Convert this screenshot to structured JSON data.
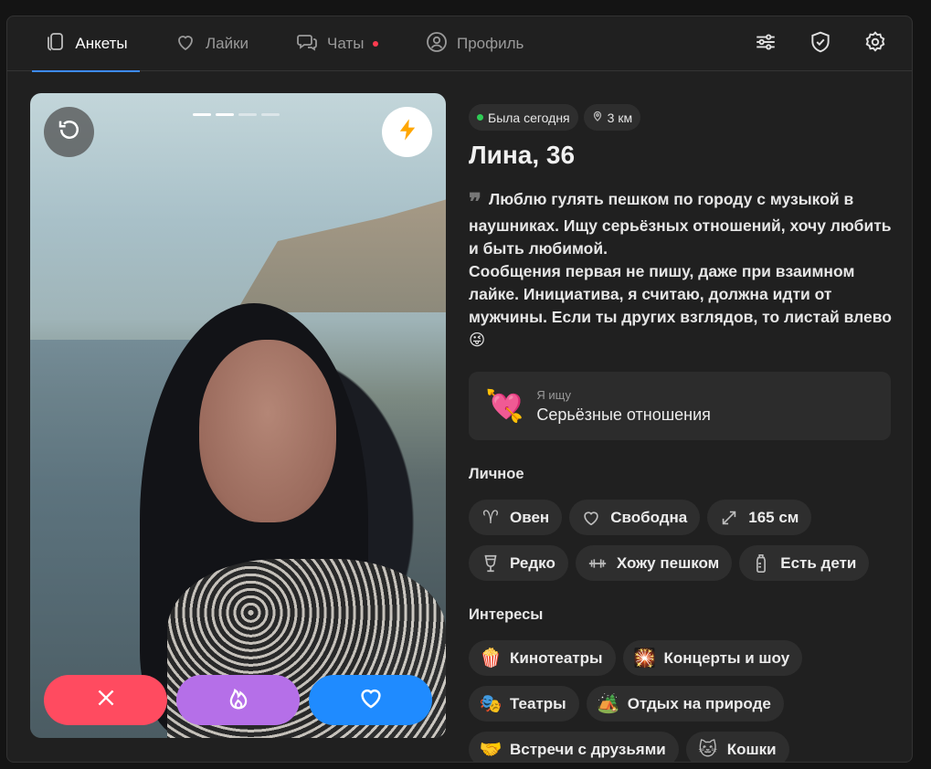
{
  "nav": {
    "tabs": [
      {
        "label": "Анкеты",
        "icon": "cards-icon",
        "active": true
      },
      {
        "label": "Лайки",
        "icon": "heart-icon",
        "active": false
      },
      {
        "label": "Чаты",
        "icon": "chat-icon",
        "active": false,
        "unread": true
      },
      {
        "label": "Профиль",
        "icon": "profile-icon",
        "active": false
      }
    ],
    "tools": [
      "filters-icon",
      "shield-icon",
      "settings-icon"
    ]
  },
  "photo": {
    "total": 4,
    "current": 2
  },
  "profile": {
    "status": "Была сегодня",
    "distance": "3 км",
    "name": "Лина, 36",
    "bio": "Люблю гулять пешком по городу с музыкой в наушниках. Ищу серьёзных отношений, хочу любить и быть любимой.\nСообщения первая не пишу, даже при взаимном лайке. Инициатива, я считаю, должна идти от мужчины. Если ты других взглядов, то листай влево😜",
    "seeking": {
      "label": "Я ищу",
      "value": "Серьёзные отношения",
      "emoji": "💘"
    }
  },
  "personal": {
    "title": "Личное",
    "items": [
      {
        "label": "Овен",
        "icon": "aries-icon"
      },
      {
        "label": "Свободна",
        "icon": "heart-outline-icon"
      },
      {
        "label": "165 см",
        "icon": "height-icon"
      },
      {
        "label": "Редко",
        "icon": "glass-icon"
      },
      {
        "label": "Хожу пешком",
        "icon": "dumbbell-icon"
      },
      {
        "label": "Есть дети",
        "icon": "baby-bottle-icon"
      }
    ]
  },
  "interests": {
    "title": "Интересы",
    "items": [
      {
        "label": "Кинотеатры",
        "emoji": "🍿"
      },
      {
        "label": "Концерты и шоу",
        "emoji": "🎇"
      },
      {
        "label": "Театры",
        "emoji": "🎭"
      },
      {
        "label": "Отдых на природе",
        "emoji": "🏕️"
      },
      {
        "label": "Встречи с друзьями",
        "emoji": "🤝"
      },
      {
        "label": "Кошки",
        "emoji": "🐱"
      }
    ]
  },
  "colors": {
    "accent": "#3d8bff",
    "dislike": "#ff4b60",
    "super": "#b56fe8",
    "like": "#1f8bff",
    "online": "#2ecc55"
  }
}
